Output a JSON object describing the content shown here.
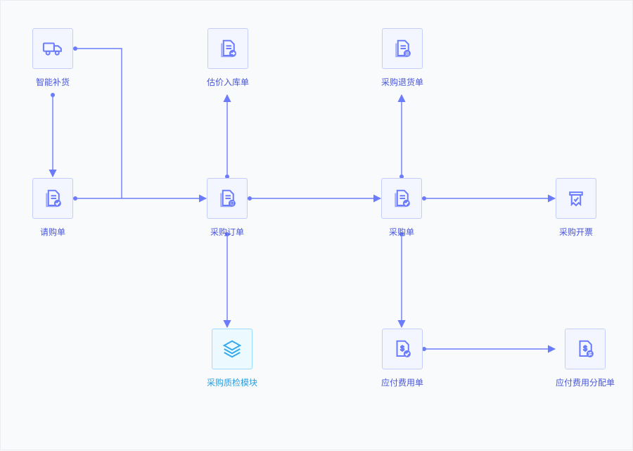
{
  "nodes": {
    "smartRestock": {
      "label": "智能补货",
      "icon": "truck-icon"
    },
    "requisition": {
      "label": "请购单",
      "icon": "doc-check-icon"
    },
    "valuationIn": {
      "label": "估价入库单",
      "icon": "doc-arrow-icon"
    },
    "purchaseOrder": {
      "label": "采购订单",
      "icon": "doc-order-icon"
    },
    "qcModule": {
      "label": "采购质检模块",
      "icon": "stack-icon"
    },
    "purchaseReturn": {
      "label": "采购退货单",
      "icon": "doc-return-icon"
    },
    "purchase": {
      "label": "采购单",
      "icon": "doc-check-icon"
    },
    "payable": {
      "label": "应付费用单",
      "icon": "doc-money-check-icon"
    },
    "invoicing": {
      "label": "采购开票",
      "icon": "receipt-icon"
    },
    "payableAlloc": {
      "label": "应付费用分配单",
      "icon": "doc-money-swap-icon"
    }
  }
}
